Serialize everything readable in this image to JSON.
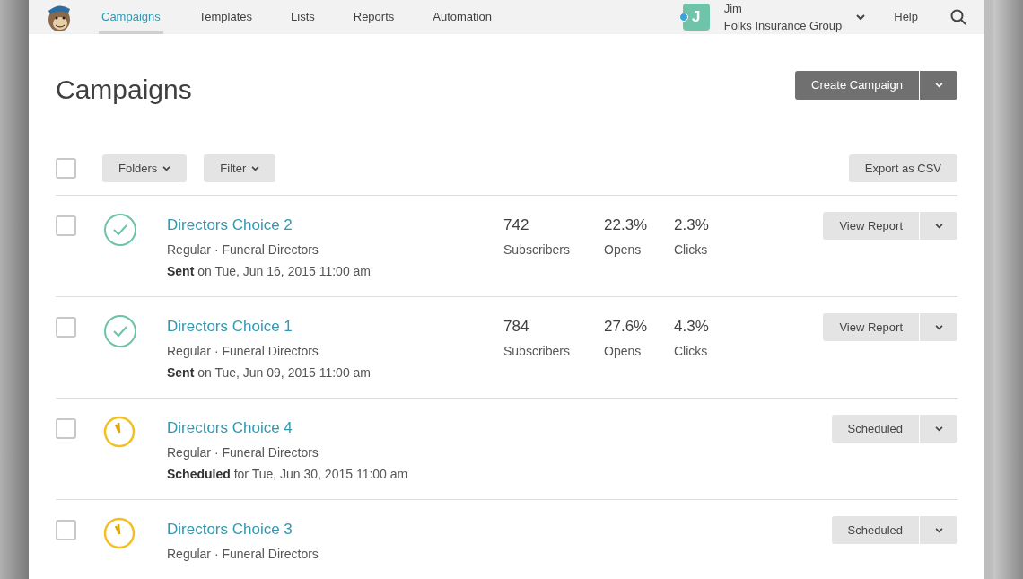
{
  "nav": {
    "tabs": [
      {
        "label": "Campaigns",
        "selected": true
      },
      {
        "label": "Templates",
        "selected": false
      },
      {
        "label": "Lists",
        "selected": false
      },
      {
        "label": "Reports",
        "selected": false
      },
      {
        "label": "Automation",
        "selected": false
      }
    ],
    "account": {
      "initial": "J",
      "name": "Jim",
      "company": "Folks Insurance Group"
    },
    "help": "Help"
  },
  "page_title": "Campaigns",
  "create_button": "Create Campaign",
  "toolbar": {
    "select_all_checked": false,
    "folders": "Folders",
    "filter": "Filter",
    "export": "Export as CSV"
  },
  "campaigns": [
    {
      "kind": "sent",
      "title": "Directors Choice 2",
      "meta": "Regular · Funeral Directors",
      "status": "**Sent** on Tue, Jun 16, 2015 11:00 am",
      "checked": false,
      "stats": [
        {
          "value": "742",
          "label": "Subscribers"
        },
        {
          "value": "22.3%",
          "label": "Opens"
        },
        {
          "value": "2.3%",
          "label": "Clicks"
        }
      ],
      "action": "View Report"
    },
    {
      "kind": "sent",
      "title": "Directors Choice 1",
      "meta": "Regular · Funeral Directors",
      "status": "**Sent** on Tue, Jun 09, 2015 11:00 am",
      "checked": false,
      "stats": [
        {
          "value": "784",
          "label": "Subscribers"
        },
        {
          "value": "27.6%",
          "label": "Opens"
        },
        {
          "value": "4.3%",
          "label": "Clicks"
        }
      ],
      "action": "View Report"
    },
    {
      "kind": "scheduled",
      "title": "Directors Choice 4",
      "meta": "Regular · Funeral Directors",
      "status": "**Scheduled** for Tue, Jun 30, 2015 11:00 am",
      "checked": false,
      "action": "Scheduled"
    },
    {
      "kind": "scheduled",
      "title": "Directors Choice 3",
      "meta": "Regular · Funeral Directors",
      "checked": false,
      "action": "Scheduled"
    }
  ]
}
